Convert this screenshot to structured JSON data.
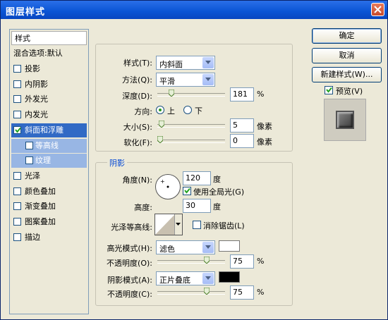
{
  "window": {
    "title": "图层样式"
  },
  "left_list": {
    "header": "样式",
    "blend_options": "混合选项:默认",
    "items": [
      {
        "label": "投影",
        "checked": false
      },
      {
        "label": "内阴影",
        "checked": false
      },
      {
        "label": "外发光",
        "checked": false
      },
      {
        "label": "内发光",
        "checked": false
      },
      {
        "label": "斜面和浮雕",
        "checked": true,
        "selected": true
      },
      {
        "label": "等高线",
        "checked": false,
        "sub": true
      },
      {
        "label": "纹理",
        "checked": false,
        "sub": true
      },
      {
        "label": "光泽",
        "checked": false
      },
      {
        "label": "颜色叠加",
        "checked": false
      },
      {
        "label": "渐变叠加",
        "checked": false
      },
      {
        "label": "图案叠加",
        "checked": false
      },
      {
        "label": "描边",
        "checked": false
      }
    ]
  },
  "structure": {
    "style_label": "样式(T):",
    "style_value": "内斜面",
    "technique_label": "方法(Q):",
    "technique_value": "平滑",
    "depth_label": "深度(D):",
    "depth_value": "181",
    "depth_unit": "%",
    "depth_fraction": 0.18,
    "direction_label": "方向:",
    "direction_up": "上",
    "direction_down": "下",
    "direction_selected": "up",
    "size_label": "大小(S):",
    "size_value": "5",
    "size_unit": "像素",
    "size_fraction": 0.02,
    "soften_label": "软化(F):",
    "soften_value": "0",
    "soften_unit": "像素",
    "soften_fraction": 0.0
  },
  "shading": {
    "title": "阴影",
    "angle_label": "角度(N):",
    "angle_value": "120",
    "angle_unit": "度",
    "global_light_label": "使用全局光(G)",
    "global_light_checked": true,
    "altitude_label": "高度:",
    "altitude_value": "30",
    "altitude_unit": "度",
    "gloss_contour_label": "光泽等高线:",
    "anti_alias_label": "消除锯齿(L)",
    "anti_alias_checked": false,
    "highlight_mode_label": "高光模式(H):",
    "highlight_mode_value": "滤色",
    "highlight_color": "#ffffff",
    "highlight_opacity_label": "不透明度(O):",
    "highlight_opacity_value": "75",
    "highlight_opacity_unit": "%",
    "highlight_opacity_fraction": 0.75,
    "shadow_mode_label": "阴影模式(A):",
    "shadow_mode_value": "正片叠底",
    "shadow_color": "#000000",
    "shadow_opacity_label": "不透明度(C):",
    "shadow_opacity_value": "75",
    "shadow_opacity_unit": "%",
    "shadow_opacity_fraction": 0.75
  },
  "buttons": {
    "ok": "确定",
    "cancel": "取消",
    "new_style": "新建样式(W)...",
    "preview_label": "预览(V)",
    "preview_checked": true
  }
}
